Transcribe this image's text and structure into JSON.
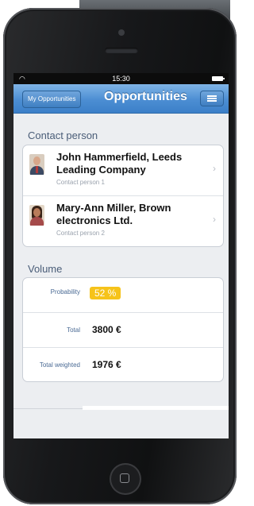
{
  "status_bar": {
    "time": "15:30"
  },
  "nav": {
    "back_label": "My Opportunities",
    "title": "Opportunities"
  },
  "contact_section": {
    "header": "Contact person",
    "contacts": [
      {
        "name": "John Hammerfield, Leeds Leading Company",
        "role": "Contact person 1"
      },
      {
        "name": "Mary-Ann Miller, Brown electronics Ltd.",
        "role": "Contact person 2"
      }
    ]
  },
  "volume_section": {
    "header": "Volume",
    "rows": [
      {
        "label": "Probability",
        "value": "52 %"
      },
      {
        "label": "Total",
        "value": "3800 €"
      },
      {
        "label": "Total weighted",
        "value": "1976 €"
      }
    ]
  },
  "colors": {
    "nav_blue": "#4c8ed3",
    "probability_badge": "#f6c31a",
    "section_header": "#4a5d78"
  }
}
